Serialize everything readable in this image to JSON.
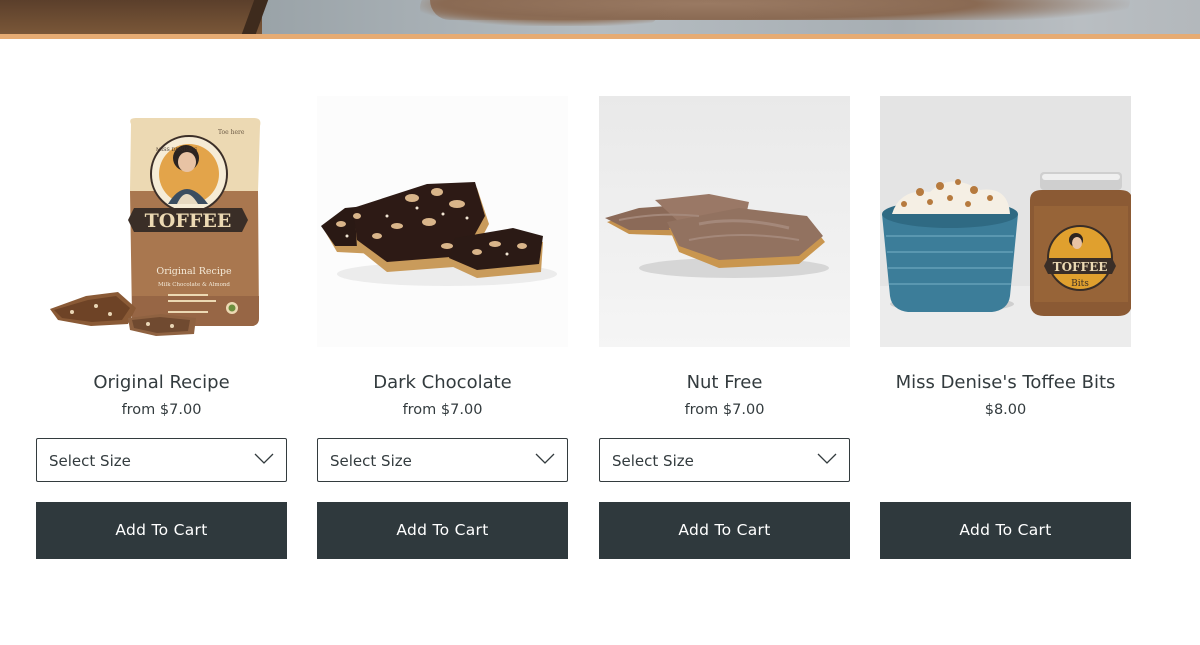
{
  "products": [
    {
      "title": "Original Recipe",
      "price": "from $7.00",
      "has_size_select": true,
      "size_select": {
        "selected": "Select Size"
      },
      "add_to_cart_label": "Add To Cart",
      "image": {
        "package_top_text": "Toe here",
        "brand_ring": "MISS DENISE'S",
        "brand": "TOFFEE",
        "flavor": "Original Recipe",
        "subflavor": "Milk Chocolate & Almond"
      }
    },
    {
      "title": "Dark Chocolate",
      "price": "from $7.00",
      "has_size_select": true,
      "size_select": {
        "selected": "Select Size"
      },
      "add_to_cart_label": "Add To Cart"
    },
    {
      "title": "Nut Free",
      "price": "from $7.00",
      "has_size_select": true,
      "size_select": {
        "selected": "Select Size"
      },
      "add_to_cart_label": "Add To Cart"
    },
    {
      "title": "Miss Denise's Toffee Bits",
      "price": "$8.00",
      "has_size_select": false,
      "add_to_cart_label": "Add To Cart",
      "image": {
        "jar_label": "TOFFEE",
        "jar_sub": "Bits"
      }
    }
  ],
  "colors": {
    "button_bg": "#2f393d",
    "accent_border": "#e6ab73",
    "text": "#333b3e"
  },
  "icons": {
    "select_chevron": "chevron-down-icon"
  }
}
